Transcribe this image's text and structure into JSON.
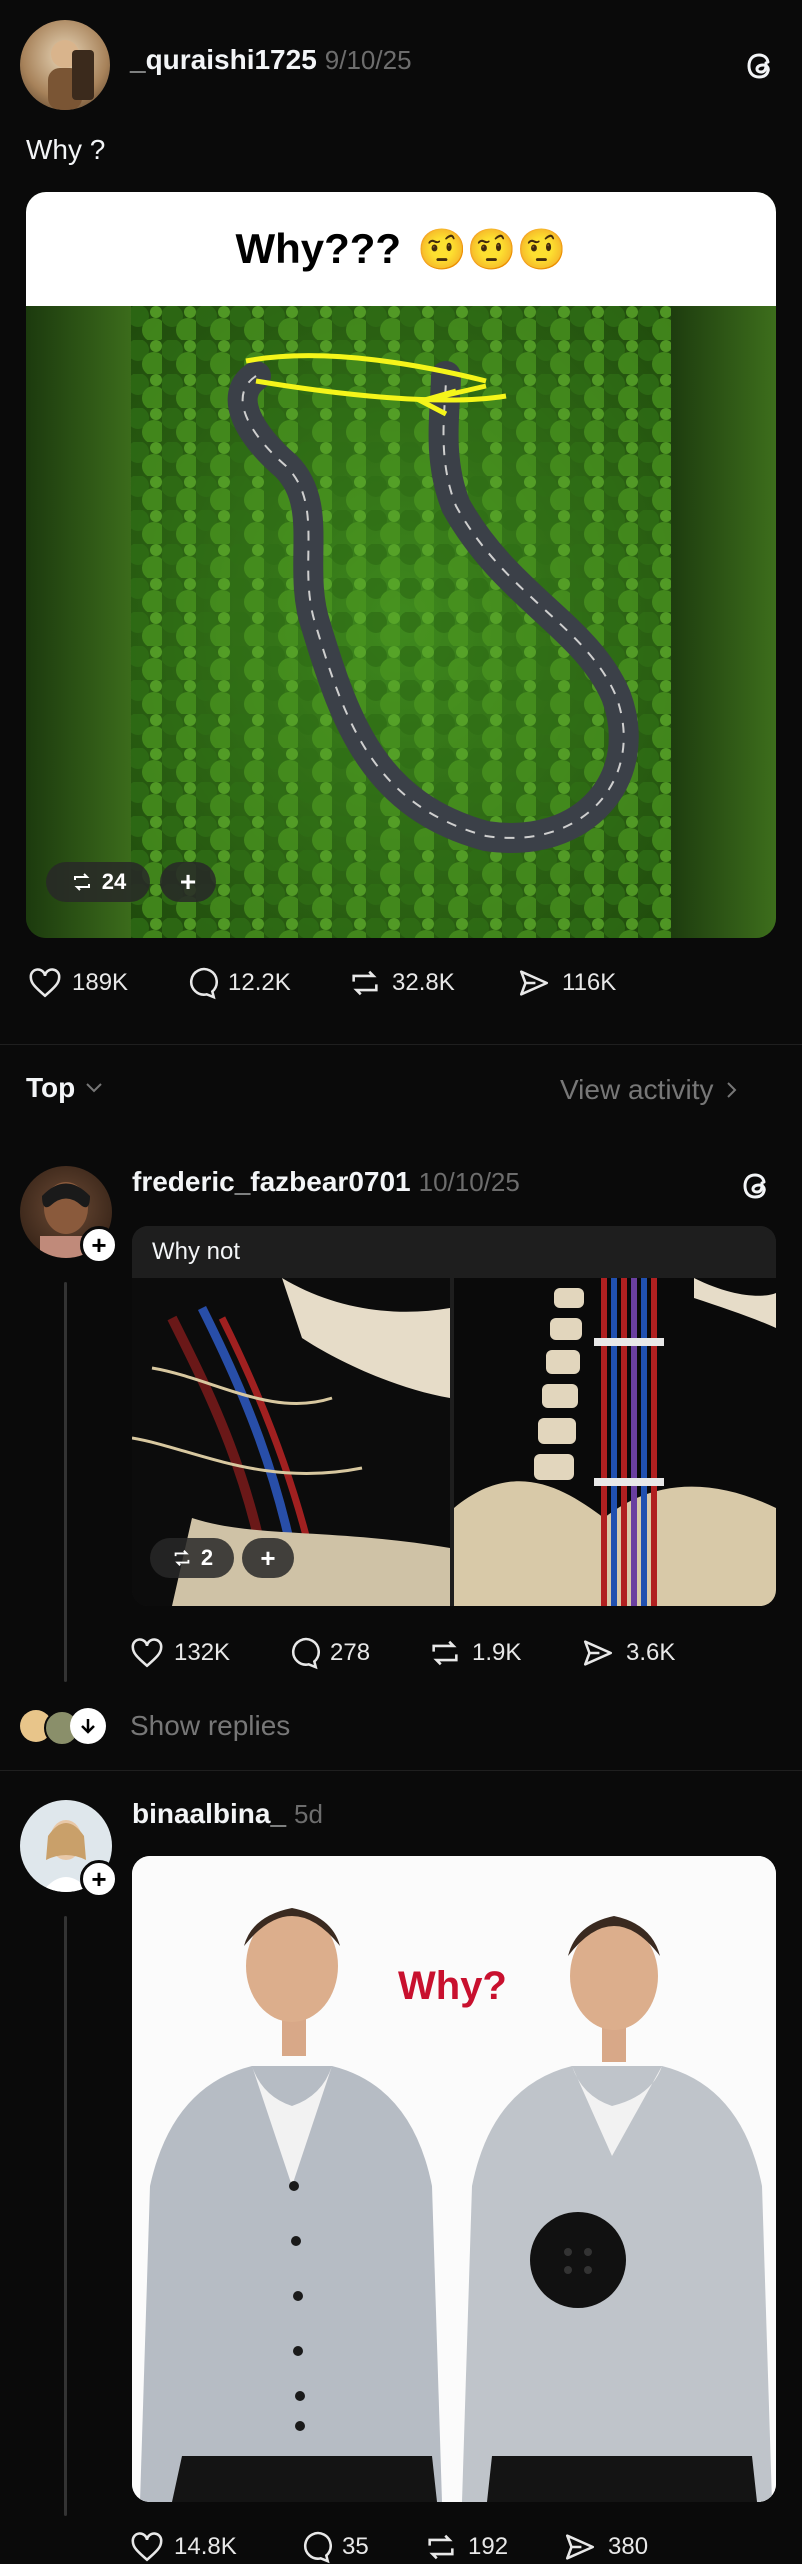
{
  "post": {
    "username": "_quraishi1725",
    "date": "9/10/25",
    "caption": "Why ?",
    "image_title": "Why???",
    "image_emoji": "🤨🤨🤨",
    "repost_pill": "24",
    "plus_pill": "+",
    "stats": {
      "likes": "189K",
      "replies": "12.2K",
      "reposts": "32.8K",
      "shares": "116K"
    }
  },
  "sort": {
    "label": "Top",
    "view_activity": "View activity"
  },
  "reply1": {
    "username": "frederic_fazbear0701",
    "date": "10/10/25",
    "text": "Why not",
    "repost_pill": "2",
    "plus_pill": "+",
    "stats": {
      "likes": "132K",
      "replies": "278",
      "reposts": "1.9K",
      "shares": "3.6K"
    },
    "show_replies": "Show replies"
  },
  "reply2": {
    "username": "binaalbina_",
    "date": "5d",
    "image_text": "Why?",
    "stats": {
      "likes": "14.8K",
      "replies": "35",
      "reposts": "192",
      "shares": "380"
    }
  },
  "colors": {
    "background": "#0a0a0a",
    "annotation_red": "#c8102e",
    "highlight_yellow": "#f5f51a"
  }
}
